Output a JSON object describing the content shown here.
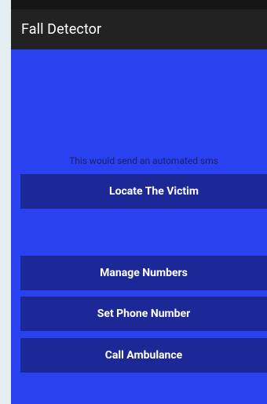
{
  "app": {
    "title": "Fall Detector"
  },
  "main": {
    "hint_text": "This would send an automated sms",
    "buttons": {
      "locate": "Locate The Victim",
      "manage_numbers": "Manage Numbers",
      "set_phone": "Set Phone Number",
      "call_ambulance": "Call Ambulance"
    }
  },
  "colors": {
    "background": "#2a41ef",
    "button": "#1b2895",
    "action_bar": "#222222"
  }
}
